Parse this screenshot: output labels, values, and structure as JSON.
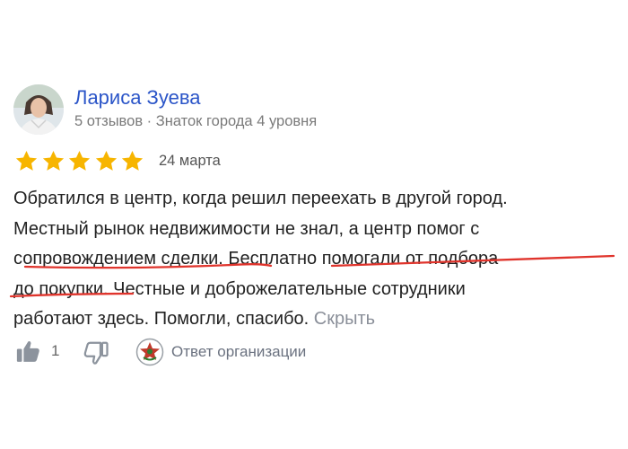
{
  "author": {
    "name": "Лариса Зуева",
    "meta": "5 отзывов · Знаток города 4 уровня"
  },
  "rating": {
    "stars": 5,
    "max": 5,
    "date": "24 марта",
    "star_color": "#f7b500"
  },
  "review": {
    "lines": [
      "Обратился в центр, когда решил переехать в другой город.",
      "Местный рынок недвижимости не знал, а центр помог с",
      "сопровождением сделки. Бесплатно помогали от подбора",
      "до покупки. Честные и доброжелательные сотрудники",
      "работают здесь. Помогли, спасибо."
    ],
    "hide_link": "Скрыть",
    "underline_color": "#e0342c"
  },
  "actions": {
    "like_icon": "thumbs-up-icon",
    "likes": "1",
    "dislike_icon": "thumbs-down-icon",
    "org_icon": "organization-logo-icon",
    "reply_label": "Ответ организации"
  }
}
